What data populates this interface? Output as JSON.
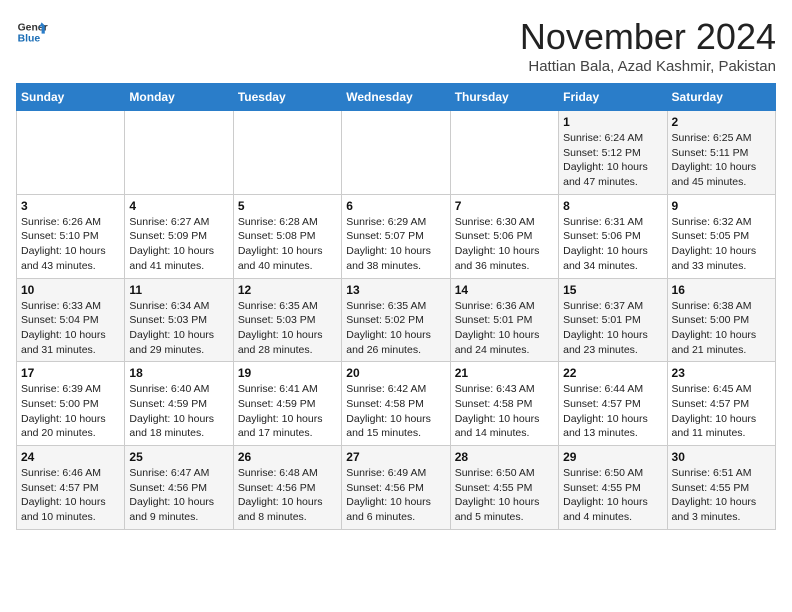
{
  "logo": {
    "line1": "General",
    "line2": "Blue"
  },
  "title": "November 2024",
  "location": "Hattian Bala, Azad Kashmir, Pakistan",
  "headers": [
    "Sunday",
    "Monday",
    "Tuesday",
    "Wednesday",
    "Thursday",
    "Friday",
    "Saturday"
  ],
  "weeks": [
    [
      {
        "day": "",
        "info": ""
      },
      {
        "day": "",
        "info": ""
      },
      {
        "day": "",
        "info": ""
      },
      {
        "day": "",
        "info": ""
      },
      {
        "day": "",
        "info": ""
      },
      {
        "day": "1",
        "info": "Sunrise: 6:24 AM\nSunset: 5:12 PM\nDaylight: 10 hours\nand 47 minutes."
      },
      {
        "day": "2",
        "info": "Sunrise: 6:25 AM\nSunset: 5:11 PM\nDaylight: 10 hours\nand 45 minutes."
      }
    ],
    [
      {
        "day": "3",
        "info": "Sunrise: 6:26 AM\nSunset: 5:10 PM\nDaylight: 10 hours\nand 43 minutes."
      },
      {
        "day": "4",
        "info": "Sunrise: 6:27 AM\nSunset: 5:09 PM\nDaylight: 10 hours\nand 41 minutes."
      },
      {
        "day": "5",
        "info": "Sunrise: 6:28 AM\nSunset: 5:08 PM\nDaylight: 10 hours\nand 40 minutes."
      },
      {
        "day": "6",
        "info": "Sunrise: 6:29 AM\nSunset: 5:07 PM\nDaylight: 10 hours\nand 38 minutes."
      },
      {
        "day": "7",
        "info": "Sunrise: 6:30 AM\nSunset: 5:06 PM\nDaylight: 10 hours\nand 36 minutes."
      },
      {
        "day": "8",
        "info": "Sunrise: 6:31 AM\nSunset: 5:06 PM\nDaylight: 10 hours\nand 34 minutes."
      },
      {
        "day": "9",
        "info": "Sunrise: 6:32 AM\nSunset: 5:05 PM\nDaylight: 10 hours\nand 33 minutes."
      }
    ],
    [
      {
        "day": "10",
        "info": "Sunrise: 6:33 AM\nSunset: 5:04 PM\nDaylight: 10 hours\nand 31 minutes."
      },
      {
        "day": "11",
        "info": "Sunrise: 6:34 AM\nSunset: 5:03 PM\nDaylight: 10 hours\nand 29 minutes."
      },
      {
        "day": "12",
        "info": "Sunrise: 6:35 AM\nSunset: 5:03 PM\nDaylight: 10 hours\nand 28 minutes."
      },
      {
        "day": "13",
        "info": "Sunrise: 6:35 AM\nSunset: 5:02 PM\nDaylight: 10 hours\nand 26 minutes."
      },
      {
        "day": "14",
        "info": "Sunrise: 6:36 AM\nSunset: 5:01 PM\nDaylight: 10 hours\nand 24 minutes."
      },
      {
        "day": "15",
        "info": "Sunrise: 6:37 AM\nSunset: 5:01 PM\nDaylight: 10 hours\nand 23 minutes."
      },
      {
        "day": "16",
        "info": "Sunrise: 6:38 AM\nSunset: 5:00 PM\nDaylight: 10 hours\nand 21 minutes."
      }
    ],
    [
      {
        "day": "17",
        "info": "Sunrise: 6:39 AM\nSunset: 5:00 PM\nDaylight: 10 hours\nand 20 minutes."
      },
      {
        "day": "18",
        "info": "Sunrise: 6:40 AM\nSunset: 4:59 PM\nDaylight: 10 hours\nand 18 minutes."
      },
      {
        "day": "19",
        "info": "Sunrise: 6:41 AM\nSunset: 4:59 PM\nDaylight: 10 hours\nand 17 minutes."
      },
      {
        "day": "20",
        "info": "Sunrise: 6:42 AM\nSunset: 4:58 PM\nDaylight: 10 hours\nand 15 minutes."
      },
      {
        "day": "21",
        "info": "Sunrise: 6:43 AM\nSunset: 4:58 PM\nDaylight: 10 hours\nand 14 minutes."
      },
      {
        "day": "22",
        "info": "Sunrise: 6:44 AM\nSunset: 4:57 PM\nDaylight: 10 hours\nand 13 minutes."
      },
      {
        "day": "23",
        "info": "Sunrise: 6:45 AM\nSunset: 4:57 PM\nDaylight: 10 hours\nand 11 minutes."
      }
    ],
    [
      {
        "day": "24",
        "info": "Sunrise: 6:46 AM\nSunset: 4:57 PM\nDaylight: 10 hours\nand 10 minutes."
      },
      {
        "day": "25",
        "info": "Sunrise: 6:47 AM\nSunset: 4:56 PM\nDaylight: 10 hours\nand 9 minutes."
      },
      {
        "day": "26",
        "info": "Sunrise: 6:48 AM\nSunset: 4:56 PM\nDaylight: 10 hours\nand 8 minutes."
      },
      {
        "day": "27",
        "info": "Sunrise: 6:49 AM\nSunset: 4:56 PM\nDaylight: 10 hours\nand 6 minutes."
      },
      {
        "day": "28",
        "info": "Sunrise: 6:50 AM\nSunset: 4:55 PM\nDaylight: 10 hours\nand 5 minutes."
      },
      {
        "day": "29",
        "info": "Sunrise: 6:50 AM\nSunset: 4:55 PM\nDaylight: 10 hours\nand 4 minutes."
      },
      {
        "day": "30",
        "info": "Sunrise: 6:51 AM\nSunset: 4:55 PM\nDaylight: 10 hours\nand 3 minutes."
      }
    ]
  ]
}
